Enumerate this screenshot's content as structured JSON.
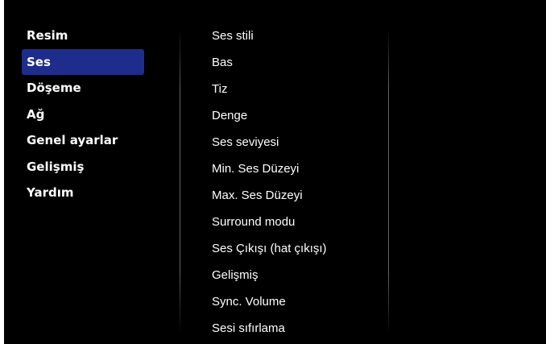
{
  "main_menu": {
    "items": [
      {
        "label": "Resim",
        "selected": false
      },
      {
        "label": "Ses",
        "selected": true
      },
      {
        "label": "Döşeme",
        "selected": false
      },
      {
        "label": "Ağ",
        "selected": false
      },
      {
        "label": "Genel ayarlar",
        "selected": false
      },
      {
        "label": "Gelişmiş",
        "selected": false
      },
      {
        "label": "Yardım",
        "selected": false
      }
    ]
  },
  "sound_menu": {
    "items": [
      {
        "label": "Ses stili"
      },
      {
        "label": "Bas"
      },
      {
        "label": "Tiz"
      },
      {
        "label": "Denge"
      },
      {
        "label": "Ses seviyesi"
      },
      {
        "label": "Min. Ses Düzeyi"
      },
      {
        "label": "Max. Ses Düzeyi"
      },
      {
        "label": "Surround modu"
      },
      {
        "label": "Ses Çıkışı (hat çıkışı)"
      },
      {
        "label": "Gelişmiş"
      },
      {
        "label": "Sync. Volume"
      },
      {
        "label": "Sesi sıfırlama"
      }
    ]
  },
  "colors": {
    "background": "#000000",
    "selection": "#1e2d8c",
    "text": "#ffffff"
  }
}
